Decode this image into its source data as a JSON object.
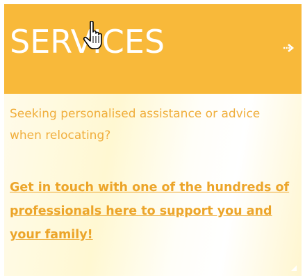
{
  "panel": {
    "title": "SERVICES",
    "title_icon": "arrow-right-icon",
    "intro_text": "Seeking personalised assistance or advice when relocating?",
    "cta_text": "Get in touch with one of the hundreds of professionals here to support you and your family!"
  },
  "colors": {
    "header_bg": "#f8b93a",
    "title_text": "#ffffff",
    "intro_text": "#f0ae3c",
    "link_text": "#eca52a",
    "body_bg": "#fff8d2"
  },
  "icons": {
    "arrow": "arrow-right-icon",
    "corner": "corner-resize-icon",
    "cursor": "hand-pointer-icon"
  }
}
